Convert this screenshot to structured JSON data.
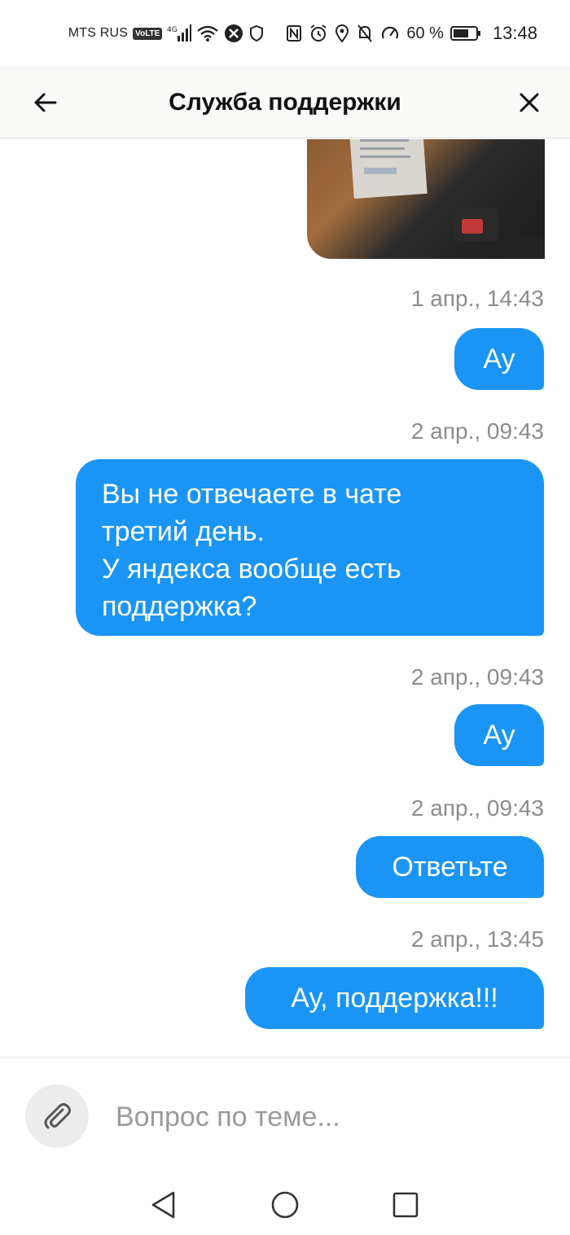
{
  "status_bar": {
    "carrier": "MTS RUS",
    "volte": "VoLTE",
    "network": "4G",
    "battery_percent": "60 %",
    "time": "13:48"
  },
  "header": {
    "title": "Служба поддержки",
    "back_icon": "arrow-left-icon",
    "close_icon": "close-icon"
  },
  "messages": [
    {
      "timestamp": "1 апр., 14:43",
      "text": "Ау"
    },
    {
      "timestamp": "2 апр., 09:43",
      "text": "Вы не отвечаете в чате\nтретий день.\nУ яндекса вообще есть\nподдержка?"
    },
    {
      "timestamp": "2 апр., 09:43",
      "text": "Ау"
    },
    {
      "timestamp": "2 апр., 09:43",
      "text": "Ответьте"
    },
    {
      "timestamp": "2 апр., 13:45",
      "text": "Ау, поддержка!!!"
    }
  ],
  "input": {
    "placeholder": "Вопрос по теме...",
    "attach_icon": "paperclip-icon"
  },
  "colors": {
    "bubble": "#1a95f5",
    "timestamp": "#8c8c8c",
    "header_bg": "#f9f9f8"
  }
}
